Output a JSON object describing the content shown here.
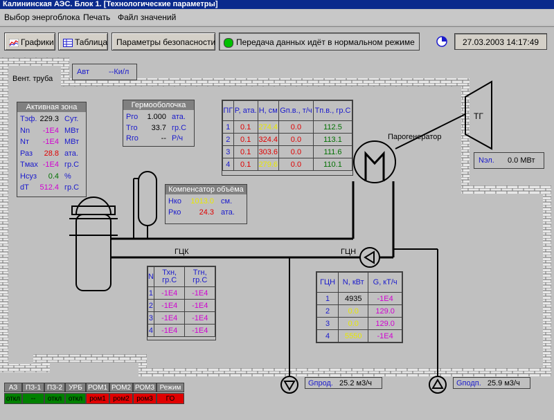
{
  "window": {
    "title": "Калининская АЭС. Блок 1. [Технологические параметры]"
  },
  "menu": {
    "items": [
      "Выбор энергоблока",
      "Печать",
      "Файл значений"
    ]
  },
  "toolbar": {
    "graphs_label": "Графики",
    "table_label": "Таблица",
    "safety_label": "Параметры безопасности",
    "status_text": "Передача данных идёт в нормальном режиме",
    "datetime": "27.03.2003 14:17:49"
  },
  "scheme": {
    "vent_label": "Вент. труба",
    "avt": {
      "label": "Авт",
      "value": "--Ки/л"
    },
    "active_zone": {
      "title": "Активная зона",
      "rows": [
        {
          "name": "Тэф.",
          "value": "229.3",
          "unit": "Сут."
        },
        {
          "name": "Nn",
          "value": "-1E4",
          "unit": "МВт"
        },
        {
          "name": "Nт",
          "value": "-1E4",
          "unit": "МВт"
        },
        {
          "name": "Раз",
          "value": "28.8",
          "unit": "ата."
        },
        {
          "name": "Tмах",
          "value": "-1E4",
          "unit": "гр.С"
        },
        {
          "name": "Нсуз",
          "value": "0.4",
          "unit": "%"
        },
        {
          "name": "dT",
          "value": "512.4",
          "unit": "гр.С"
        }
      ]
    },
    "containment": {
      "title": "Гермооболочка",
      "rows": [
        {
          "name": "Pго",
          "value": "1.000",
          "unit": "ата."
        },
        {
          "name": "Tго",
          "value": "33.7",
          "unit": "гр.С"
        },
        {
          "name": "Rго",
          "value": "--",
          "unit": "Р/ч"
        }
      ]
    },
    "pressurizer": {
      "title": "Компенсатор объёма",
      "rows": [
        {
          "name": "Нко",
          "value": "1013.0",
          "unit": "см."
        },
        {
          "name": "Рко",
          "value": "24.3",
          "unit": "ата."
        }
      ]
    },
    "sg_table": {
      "headers": [
        "ПГ",
        "P, ата.",
        "H, см",
        "Gп.в., т/ч",
        "Tп.в., гр.С"
      ],
      "rows": [
        [
          "1",
          "0.1",
          "274.4",
          "0.0",
          "112.5"
        ],
        [
          "2",
          "0.1",
          "324.4",
          "0.0",
          "113.1"
        ],
        [
          "3",
          "0.1",
          "303.6",
          "0.0",
          "111.6"
        ],
        [
          "4",
          "0.1",
          "279.6",
          "0.0",
          "110.1"
        ]
      ]
    },
    "sg_label": "Парогенератор",
    "tg_label": "ТГ",
    "nel": {
      "label": "Nэл.",
      "value": "0.0 МВт"
    },
    "gcn_label_left": "ГЦК",
    "gcn_label_right": "ГЦН",
    "loop_table": {
      "headers": [
        "N",
        "Тхн, гр.С",
        "Тгн, гр.С"
      ],
      "rows": [
        [
          "1",
          "-1E4",
          "-1E4"
        ],
        [
          "2",
          "-1E4",
          "-1E4"
        ],
        [
          "3",
          "-1E4",
          "-1E4"
        ],
        [
          "4",
          "-1E4",
          "-1E4"
        ]
      ]
    },
    "pump_table": {
      "headers": [
        "ГЦН",
        "N, кВт",
        "G, кТ/ч"
      ],
      "rows": [
        [
          "1",
          "4935",
          "-1E4"
        ],
        [
          "2",
          "0.0",
          "129.0"
        ],
        [
          "3",
          "0.0",
          "129.0"
        ],
        [
          "4",
          "5550",
          "-1E4"
        ]
      ]
    },
    "gprod": {
      "label": "Gпрод.",
      "value": "25.2 м3/ч"
    },
    "gpodp": {
      "label": "Gподп.",
      "value": "25.9 м3/ч"
    }
  },
  "alarm_panel": {
    "headers": [
      "АЗ",
      "ПЗ-1",
      "ПЗ-2",
      "УРБ",
      "РОМ1",
      "РОМ2",
      "РОМ3",
      "Режим"
    ],
    "values": [
      "откл",
      "--",
      "откл",
      "откл",
      "ром1",
      "ром2",
      "ром3",
      "ГО"
    ]
  },
  "colors": {
    "titlebar": "#0a2a8c",
    "status_ok": "#00c000",
    "alarm_ok": "#008000",
    "alarm_active": "#e00000",
    "brick": "#e8e8e8",
    "label_blue": "#1a1acc",
    "value_magenta": "#d000d0",
    "value_yellow": "#e8e800"
  }
}
